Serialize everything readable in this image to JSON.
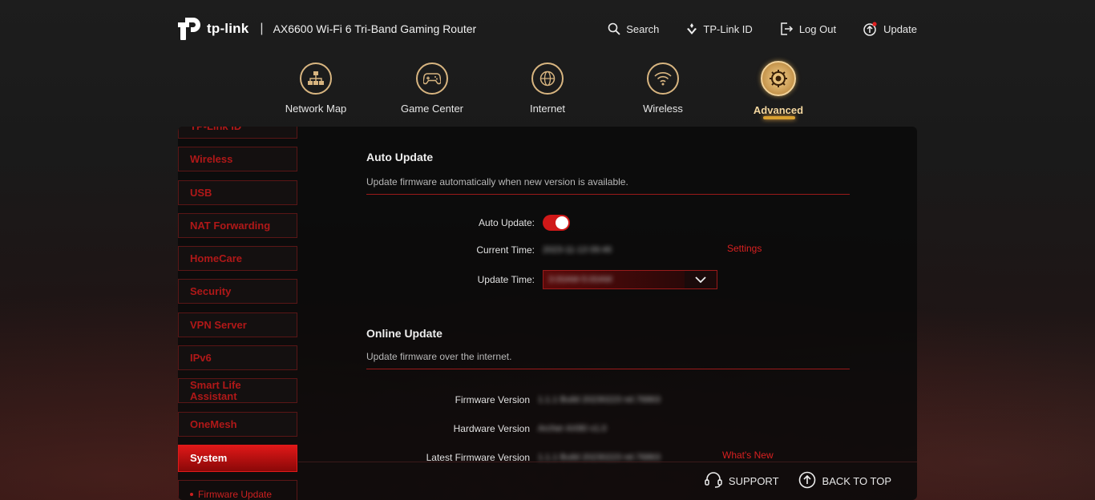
{
  "header": {
    "brand": "tp-link",
    "separator": "|",
    "model": "AX6600 Wi-Fi 6 Tri-Band Gaming Router",
    "actions": [
      {
        "label": "Search",
        "icon": "search-icon"
      },
      {
        "label": "TP-Link ID",
        "icon": "tplink-id-icon"
      },
      {
        "label": "Log Out",
        "icon": "logout-icon"
      },
      {
        "label": "Update",
        "icon": "update-icon"
      }
    ]
  },
  "nav": {
    "items": [
      {
        "label": "Network Map",
        "icon": "network-map-icon"
      },
      {
        "label": "Game Center",
        "icon": "gamepad-icon"
      },
      {
        "label": "Internet",
        "icon": "globe-icon"
      },
      {
        "label": "Wireless",
        "icon": "wifi-icon"
      },
      {
        "label": "Advanced",
        "icon": "gear-icon",
        "active": true
      }
    ]
  },
  "sidebar": {
    "items": [
      {
        "label": "TP-Link ID"
      },
      {
        "label": "Wireless"
      },
      {
        "label": "USB"
      },
      {
        "label": "NAT Forwarding"
      },
      {
        "label": "HomeCare"
      },
      {
        "label": "Security"
      },
      {
        "label": "VPN Server"
      },
      {
        "label": "IPv6"
      },
      {
        "label": "Smart Life Assistant"
      },
      {
        "label": "OneMesh"
      },
      {
        "label": "System",
        "active": true
      }
    ],
    "sub_item": "Firmware Update"
  },
  "auto_update": {
    "title": "Auto Update",
    "description": "Update firmware automatically when new version is available.",
    "auto_update_label": "Auto Update:",
    "auto_update_on": true,
    "current_time_label": "Current Time:",
    "current_time_value": "2023-11-13 09:46",
    "settings_link": "Settings",
    "update_time_label": "Update Time:",
    "update_time_value": "3:00AM-5:00AM"
  },
  "online_update": {
    "title": "Online Update",
    "description": "Update firmware over the internet.",
    "firmware_label": "Firmware Version",
    "firmware_value": "1.1.1 Build 20230223 rel.76863",
    "hardware_label": "Hardware Version",
    "hardware_value": "Archer AX80 v1.0",
    "latest_label": "Latest Firmware Version",
    "latest_value": "1.1.1 Build 20230223 rel.76863",
    "whats_new_link": "What's New"
  },
  "footer": {
    "support": "SUPPORT",
    "back_to_top": "BACK TO TOP"
  },
  "colors": {
    "accent_red": "#d01818",
    "gold": "#d8b580"
  }
}
